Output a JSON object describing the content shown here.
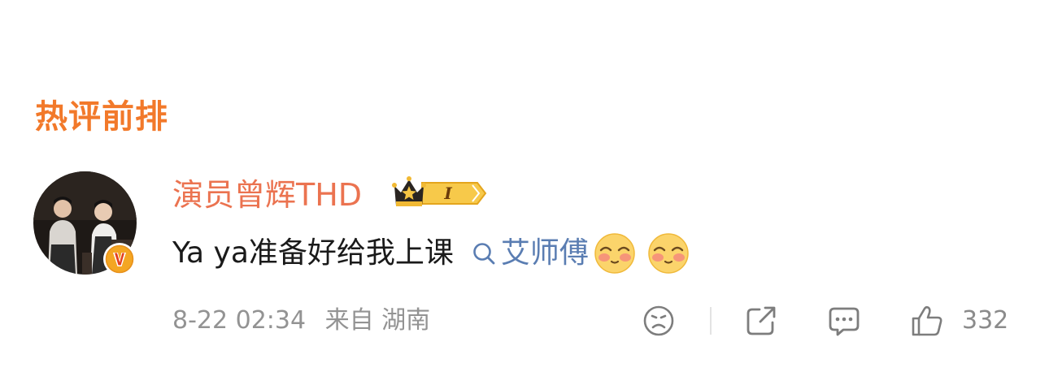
{
  "section": {
    "title": "热评前排"
  },
  "comment": {
    "author": {
      "name": "演员曾辉THD",
      "avatar_icon": "avatar-photo",
      "verified_badge_icon": "v-verified-icon",
      "fan_badge": {
        "icon": "crown-icon",
        "level": "I"
      }
    },
    "text": "Ya ya准备好给我上课",
    "topic_link": {
      "icon": "search-icon",
      "label": "艾师傅"
    },
    "emojis": [
      "shy-face-emoji",
      "shy-face-emoji"
    ],
    "date": "8-22 02:34",
    "source": "来自 湖南"
  },
  "actions": {
    "dislike_icon": "sad-face-icon",
    "share_icon": "share-icon",
    "reply_icon": "comment-icon",
    "like_icon": "thumbs-up-icon",
    "like_count": "332"
  },
  "colors": {
    "section_title": "#f2792a",
    "username": "#eb7350",
    "topic_link": "#5a7db2",
    "meta_text": "#939393",
    "badge_gold": "#f5c443"
  }
}
